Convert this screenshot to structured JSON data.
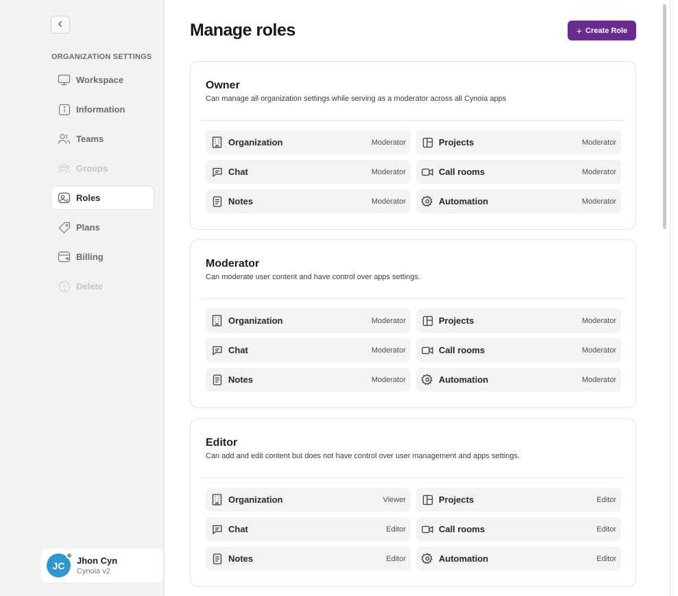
{
  "sidebar": {
    "section_label": "ORGANIZATION SETTINGS",
    "items": [
      {
        "label": "Workspace",
        "icon": "monitor-icon",
        "state": "default"
      },
      {
        "label": "Information",
        "icon": "info-icon",
        "state": "default"
      },
      {
        "label": "Teams",
        "icon": "users-icon",
        "state": "default"
      },
      {
        "label": "Groups",
        "icon": "group-icon",
        "state": "disabled"
      },
      {
        "label": "Roles",
        "icon": "user-role-icon",
        "state": "active"
      },
      {
        "label": "Plans",
        "icon": "tag-icon",
        "state": "default"
      },
      {
        "label": "Billing",
        "icon": "billing-icon",
        "state": "default"
      },
      {
        "label": "Delete",
        "icon": "alert-icon",
        "state": "disabled"
      }
    ],
    "user": {
      "initials": "JC",
      "name": "Jhon Cyn",
      "subtitle": "Cynoia v2"
    }
  },
  "header": {
    "title": "Manage roles",
    "create_label": "Create Role"
  },
  "colors": {
    "accent": "#6a2c91",
    "avatar": "#2f97cf"
  },
  "roles": [
    {
      "name": "Owner",
      "description": "Can manage all organization settings while serving as a moderator across all Cynoia apps",
      "permissions": [
        {
          "app": "Organization",
          "level": "Moderator",
          "icon": "building-icon"
        },
        {
          "app": "Projects",
          "level": "Moderator",
          "icon": "layout-icon"
        },
        {
          "app": "Chat",
          "level": "Moderator",
          "icon": "chat-icon"
        },
        {
          "app": "Call rooms",
          "level": "Moderator",
          "icon": "video-icon"
        },
        {
          "app": "Notes",
          "level": "Moderator",
          "icon": "note-icon"
        },
        {
          "app": "Automation",
          "level": "Moderator",
          "icon": "gear-icon"
        }
      ]
    },
    {
      "name": "Moderator",
      "description": "Can moderate user content and have control over apps settings.",
      "permissions": [
        {
          "app": "Organization",
          "level": "Moderator",
          "icon": "building-icon"
        },
        {
          "app": "Projects",
          "level": "Moderator",
          "icon": "layout-icon"
        },
        {
          "app": "Chat",
          "level": "Moderator",
          "icon": "chat-icon"
        },
        {
          "app": "Call rooms",
          "level": "Moderator",
          "icon": "video-icon"
        },
        {
          "app": "Notes",
          "level": "Moderator",
          "icon": "note-icon"
        },
        {
          "app": "Automation",
          "level": "Moderator",
          "icon": "gear-icon"
        }
      ]
    },
    {
      "name": "Editor",
      "description": "Can add and edit content but does not have control over user management and apps settings.",
      "permissions": [
        {
          "app": "Organization",
          "level": "Viewer",
          "icon": "building-icon"
        },
        {
          "app": "Projects",
          "level": "Editor",
          "icon": "layout-icon"
        },
        {
          "app": "Chat",
          "level": "Editor",
          "icon": "chat-icon"
        },
        {
          "app": "Call rooms",
          "level": "Editor",
          "icon": "video-icon"
        },
        {
          "app": "Notes",
          "level": "Editor",
          "icon": "note-icon"
        },
        {
          "app": "Automation",
          "level": "Editor",
          "icon": "gear-icon"
        }
      ]
    }
  ]
}
